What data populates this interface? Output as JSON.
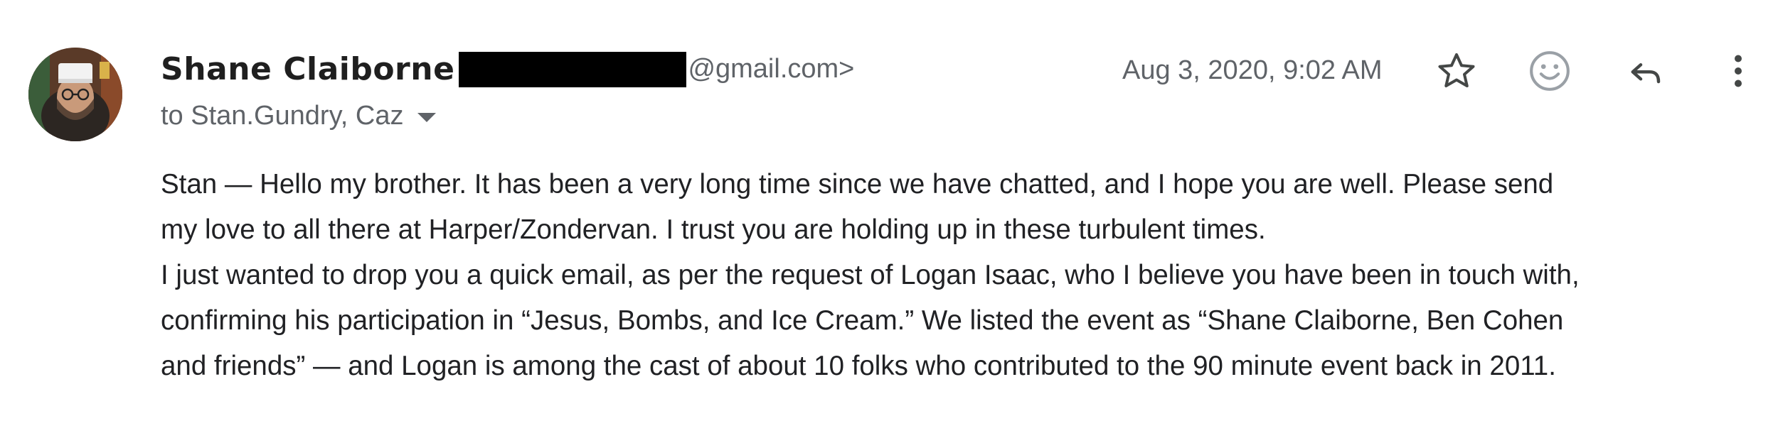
{
  "sender": {
    "name": "Shane Claiborne",
    "email_suffix": "@gmail.com>",
    "avatar": "avatar"
  },
  "recipients": {
    "text": "to Stan.Gundry, Caz",
    "expand_icon": "caret-down-icon"
  },
  "date": "Aug 3, 2020, 9:02 AM",
  "actions": {
    "star_icon": "star-icon",
    "emoji_icon": "emoji-reaction-icon",
    "reply_icon": "reply-icon",
    "more_icon": "more-vert-icon"
  },
  "body_lines": [
    "Stan — Hello my brother.  It has been a very long time since we have chatted, and I hope you are well.  Please send",
    "my love to all there at Harper/Zondervan.  I trust you are holding up in these turbulent times.",
    "I just wanted to drop you a quick email, as per the request of Logan Isaac, who I believe you have been in touch with,",
    "confirming his participation in “Jesus, Bombs, and Ice Cream.”  We listed the event as “Shane Claiborne, Ben Cohen",
    "and friends” — and Logan is among the cast of about 10 folks who contributed to the 90 minute event back in 2011."
  ],
  "colors": {
    "text_primary": "#202124",
    "text_secondary": "#5f6368",
    "redaction": "#000000"
  }
}
